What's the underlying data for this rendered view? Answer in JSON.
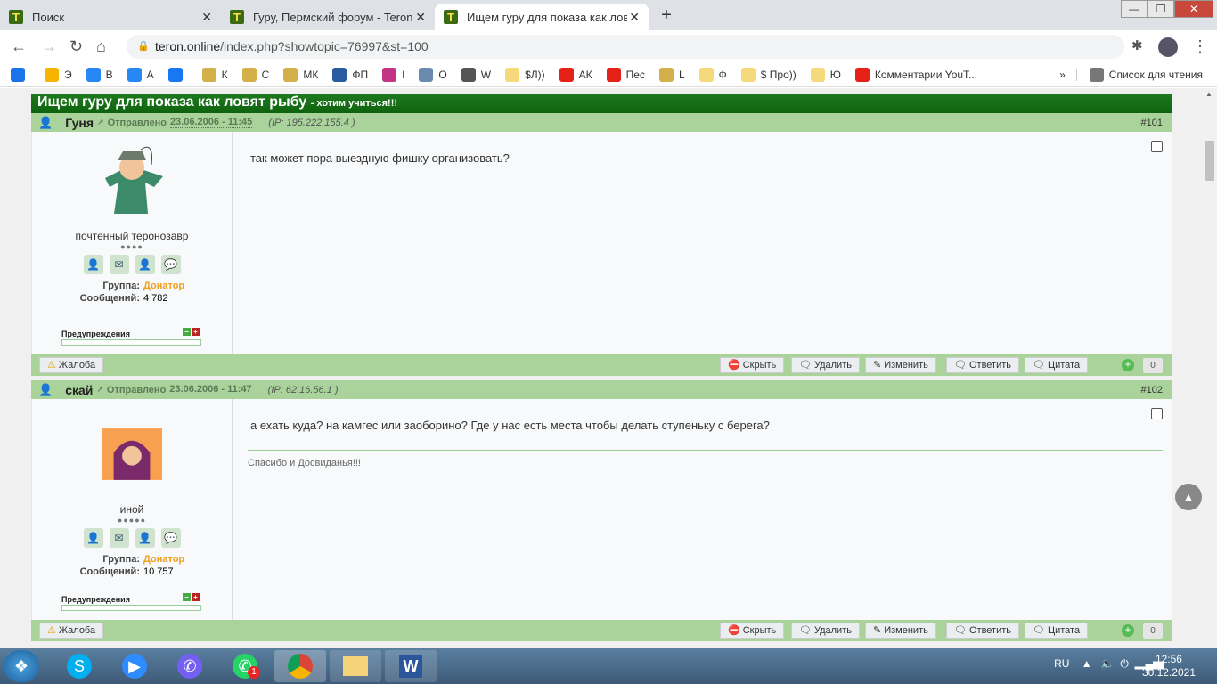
{
  "browser": {
    "tabs": [
      {
        "title": "Поиск",
        "active": false
      },
      {
        "title": "Гуру, Пермский форум - Teron.o",
        "active": false
      },
      {
        "title": "Ищем гуру для показа как ловят",
        "active": true
      }
    ],
    "tab_logo": "Т",
    "url_domain": "teron.online",
    "url_path": "/index.php?showtopic=76997&st=100",
    "bookmarks": [
      {
        "label": "",
        "icon": "mail-icon",
        "color": "#1a73e8"
      },
      {
        "label": "Э",
        "icon": "windows-icon",
        "color": "#f4b400"
      },
      {
        "label": "В",
        "icon": "vk-icon",
        "color": "#2787f5"
      },
      {
        "label": "А",
        "icon": "vk-icon",
        "color": "#2787f5"
      },
      {
        "label": "",
        "icon": "facebook-icon",
        "color": "#1877f2"
      },
      {
        "label": "К",
        "icon": "rf-icon",
        "color": "#d4b04a"
      },
      {
        "label": "С",
        "icon": "rf-icon",
        "color": "#d4b04a"
      },
      {
        "label": "МК",
        "icon": "rf-icon",
        "color": "#d4b04a"
      },
      {
        "label": "ФП",
        "icon": "fp-icon",
        "color": "#2a5aa0"
      },
      {
        "label": "I",
        "icon": "instagram-icon",
        "color": "#c13584"
      },
      {
        "label": "О",
        "icon": "globe-feather-icon",
        "color": "#6a8ab0"
      },
      {
        "label": "W",
        "icon": "wikipedia-icon",
        "color": "#555555"
      },
      {
        "label": "$Л))",
        "icon": "folder-icon",
        "color": "#f6d97a"
      },
      {
        "label": "АК",
        "icon": "youtube-icon",
        "color": "#e62117"
      },
      {
        "label": "Пес",
        "icon": "youtube-icon",
        "color": "#e62117"
      },
      {
        "label": "L",
        "icon": "rf-icon",
        "color": "#d4b04a"
      },
      {
        "label": "Ф",
        "icon": "folder-icon",
        "color": "#f6d97a"
      },
      {
        "label": "$ Про))",
        "icon": "folder-icon",
        "color": "#f6d97a"
      },
      {
        "label": "Ю",
        "icon": "folder-icon",
        "color": "#f6d97a"
      },
      {
        "label": "Комментарии YouT...",
        "icon": "youtube-icon",
        "color": "#e62117"
      }
    ],
    "more": "»",
    "reading_list": "Список для чтения"
  },
  "topic": {
    "title": "Ищем гуру для показа как ловят рыбу",
    "subtitle": "- хотим учиться!!!"
  },
  "labels": {
    "sent": "Отправлено",
    "group": "Группа:",
    "posts": "Сообщений:",
    "warnings": "Предупреждения",
    "complaint": "Жалоба",
    "hide": "Скрыть",
    "delete": "Удалить",
    "edit": "Изменить",
    "reply": "Ответить",
    "quote": "Цитата",
    "ip_prefix": "(IP:",
    "ip_suffix": ")"
  },
  "posts": [
    {
      "author": "Гуня",
      "date": "23.06.2006 - 11:45",
      "ip": "195.222.155.4",
      "number": "#101",
      "rank": "почтенный теронозавр",
      "pips": "●●●●",
      "group": "Донатор",
      "post_count": "4 782",
      "text": "так может пора выездную фишку организовать?",
      "signature": "",
      "rating": "0"
    },
    {
      "author": "скай",
      "date": "23.06.2006 - 11:47",
      "ip": "62.16.56.1",
      "number": "#102",
      "rank": "иной",
      "pips": "●●●●●",
      "group": "Донатор",
      "post_count": "10 757",
      "text": "а ехать куда? на камгес или заоборино? Где у нас есть места чтобы делать ступеньку с берега?",
      "signature": "Спасибо и Досвиданья!!!",
      "rating": "0"
    }
  ],
  "taskbar": {
    "lang": "RU",
    "time": "12:56",
    "date": "30.12.2021",
    "whatsapp_badge": "1"
  }
}
